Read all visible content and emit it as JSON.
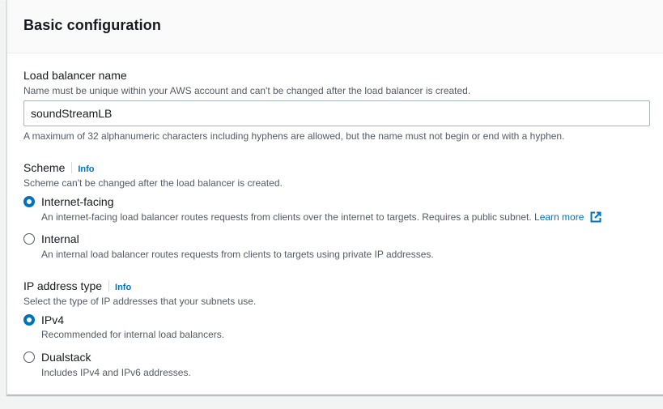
{
  "section": {
    "title": "Basic configuration"
  },
  "lb_name": {
    "label": "Load balancer name",
    "description": "Name must be unique within your AWS account and can't be changed after the load balancer is created.",
    "value": "soundStreamLB",
    "constraint": "A maximum of 32 alphanumeric characters including hyphens are allowed, but the name must not begin or end with a hyphen."
  },
  "scheme": {
    "label": "Scheme",
    "info": "Info",
    "description": "Scheme can't be changed after the load balancer is created.",
    "options": [
      {
        "label": "Internet-facing",
        "description": "An internet-facing load balancer routes requests from clients over the internet to targets. Requires a public subnet.",
        "link": "Learn more",
        "selected": true
      },
      {
        "label": "Internal",
        "description": "An internal load balancer routes requests from clients to targets using private IP addresses.",
        "selected": false
      }
    ]
  },
  "ip_type": {
    "label": "IP address type",
    "info": "Info",
    "description": "Select the type of IP addresses that your subnets use.",
    "options": [
      {
        "label": "IPv4",
        "description": "Recommended for internal load balancers.",
        "selected": true
      },
      {
        "label": "Dualstack",
        "description": "Includes IPv4 and IPv6 addresses.",
        "selected": false
      }
    ]
  },
  "colors": {
    "link": "#0073bb",
    "text": "#16191f",
    "secondary_text": "#545b64",
    "header_bg": "#fafafa"
  },
  "icons": {
    "external_link": "external-link-icon"
  }
}
